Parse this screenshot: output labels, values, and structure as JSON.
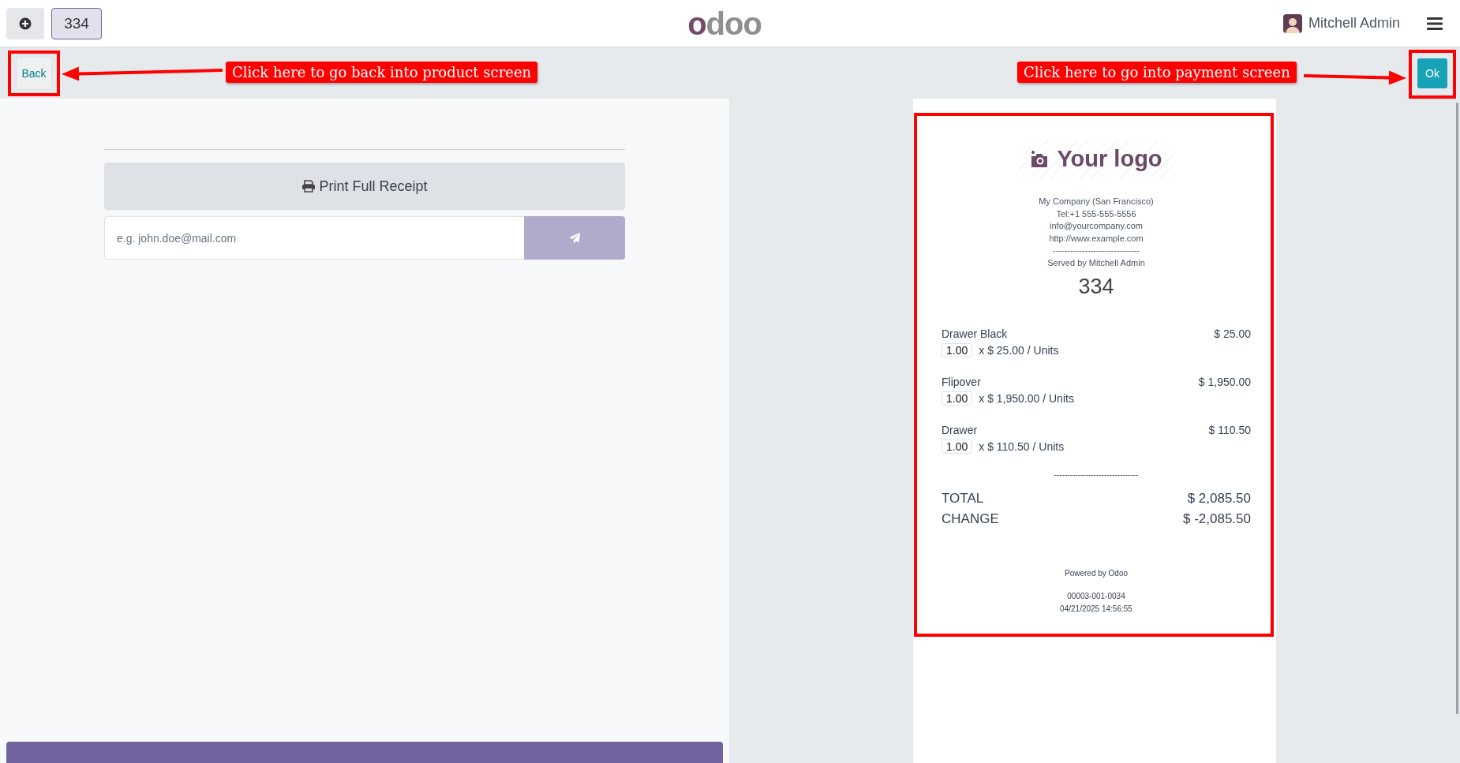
{
  "top_bar": {
    "order_number": "334",
    "logo": "odoo",
    "user": "Mitchell Admin"
  },
  "action_bar": {
    "back": "Back",
    "ok": "Ok"
  },
  "left_panel": {
    "print_button": "Print Full Receipt",
    "email": {
      "placeholder": "e.g. john.doe@mail.com"
    }
  },
  "receipt": {
    "logo_text": "Your logo",
    "header": [
      "My Company (San Francisco)",
      "Tel:+1 555-555-5556",
      "info@yourcompany.com",
      "http://www.example.com",
      "------------------------------",
      "Served by Mitchell Admin"
    ],
    "order_number": "334",
    "lines": [
      {
        "product": "Drawer Black",
        "price": "$ 25.00",
        "quantity": "1.00",
        "unit_price": "x $ 25.00 / Units"
      },
      {
        "product": "Flipover",
        "price": "$ 1,950.00",
        "quantity": "1.00",
        "unit_price": "x $ 1,950.00 / Units"
      },
      {
        "product": "Drawer",
        "price": "$ 110.50",
        "quantity": "1.00",
        "unit_price": "x $ 110.50 / Units"
      }
    ],
    "separator": "--------------------------------",
    "totals": [
      {
        "label": "TOTAL",
        "amount": "$ 2,085.50"
      },
      {
        "label": "CHANGE",
        "amount": "$ -2,085.50"
      }
    ],
    "footer": "Powered by Odoo",
    "reference": "00003-001-0034",
    "date": "04/21/2025 14:56:55"
  },
  "annotations": [
    {
      "text": "Click here to go back into product screen",
      "kind": "leftward"
    },
    {
      "text": "Click here to go into payment screen",
      "kind": "rightward"
    }
  ]
}
